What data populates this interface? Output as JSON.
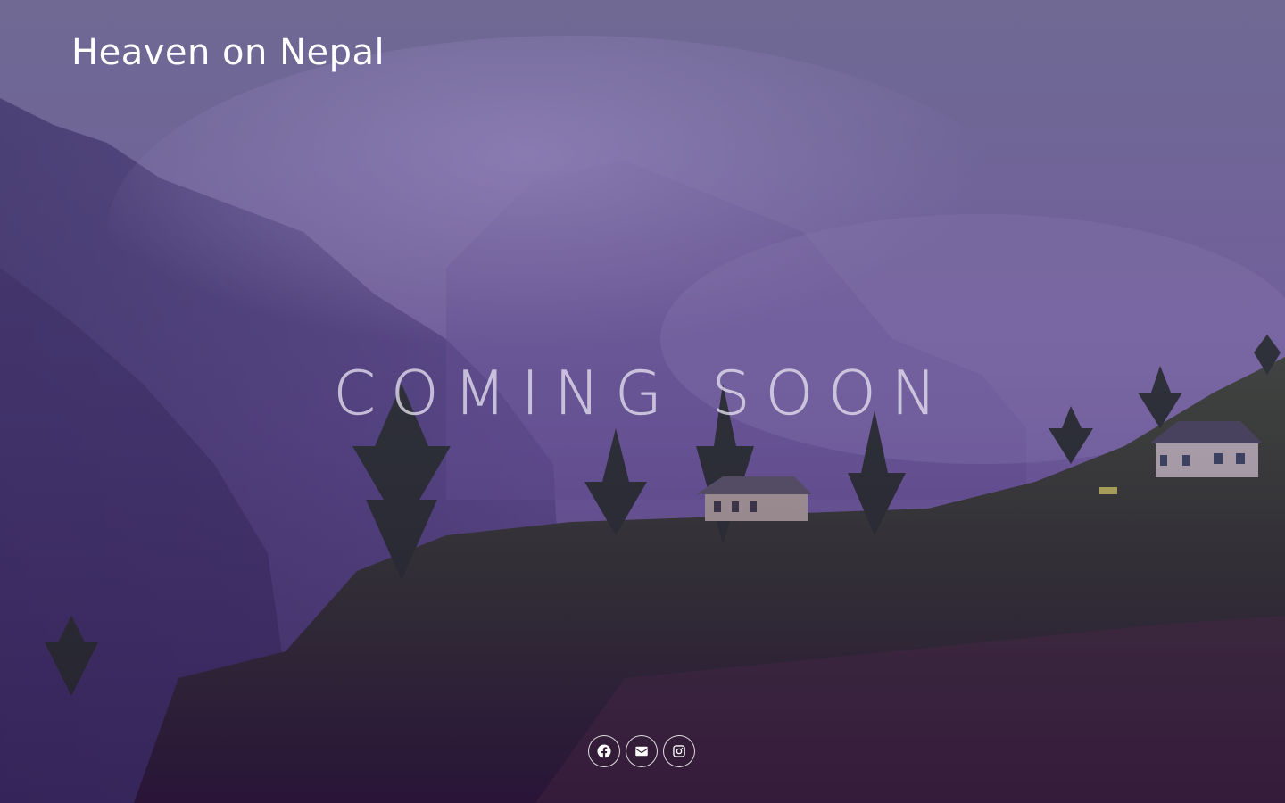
{
  "site": {
    "title": "Heaven on Nepal"
  },
  "hero": {
    "headline": "COMING SOON",
    "background_description_icon": "misty-mountain-landscape-image"
  },
  "socials": [
    {
      "name": "facebook",
      "icon": "facebook-icon"
    },
    {
      "name": "email",
      "icon": "envelope-icon"
    },
    {
      "name": "instagram",
      "icon": "instagram-icon"
    }
  ],
  "colors": {
    "overlay_tint": "#5a4e8c",
    "text": "#ffffff"
  }
}
